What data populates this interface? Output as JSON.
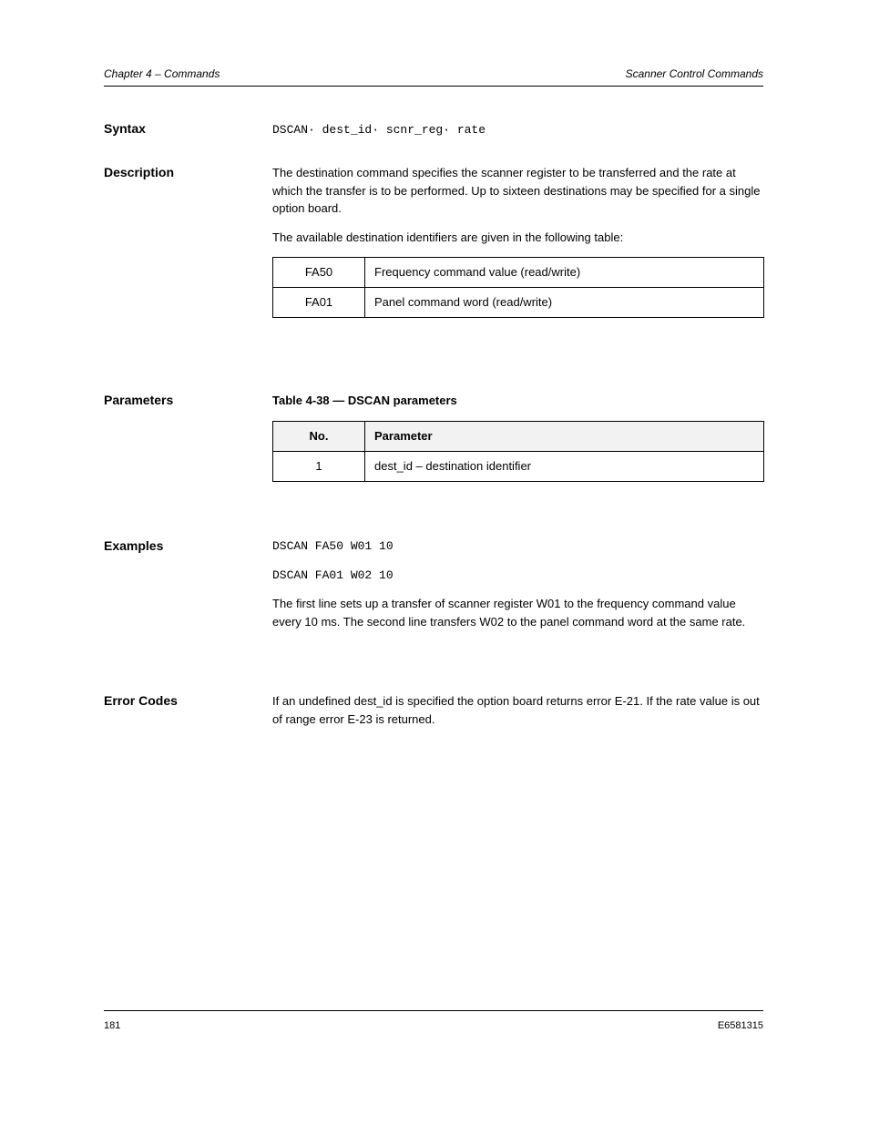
{
  "header": {
    "left": "Chapter 4 – Commands",
    "right": "Scanner Control Commands"
  },
  "footer": {
    "left": "181",
    "right": "E6581315"
  },
  "syntax": {
    "label": "Syntax",
    "value": "DSCAN· dest_id· scnr_reg· rate"
  },
  "description": {
    "label": "Description",
    "para1": "The destination command specifies the scanner register to be transferred and the rate at which the transfer is to be performed. Up to sixteen destinations may be specified for a single option board.",
    "para2": "The available destination identifiers are given in the following table:"
  },
  "dest_table": {
    "rows": [
      {
        "id": "FA50",
        "desc": "Frequency command value (read/write)"
      },
      {
        "id": "FA01",
        "desc": "Panel command word (read/write)"
      }
    ]
  },
  "parameters": {
    "label": "Parameters",
    "caption": "Table 4-38 — DSCAN parameters",
    "headers": {
      "id": "No.",
      "desc": "Parameter"
    },
    "rows": [
      {
        "id": "1",
        "desc": "dest_id – destination identifier"
      }
    ]
  },
  "examples": {
    "label": "Examples",
    "lines": [
      "DSCAN  FA50  W01  10",
      "DSCAN  FA01  W02  10"
    ],
    "note": "The first line sets up a transfer of scanner register W01 to the frequency command value every 10 ms. The second line transfers W02 to the panel command word at the same rate."
  },
  "errors": {
    "label": "Error Codes",
    "text": "If an undefined dest_id is specified the option board returns error E-21. If the rate value is out of range error E-23 is returned."
  }
}
